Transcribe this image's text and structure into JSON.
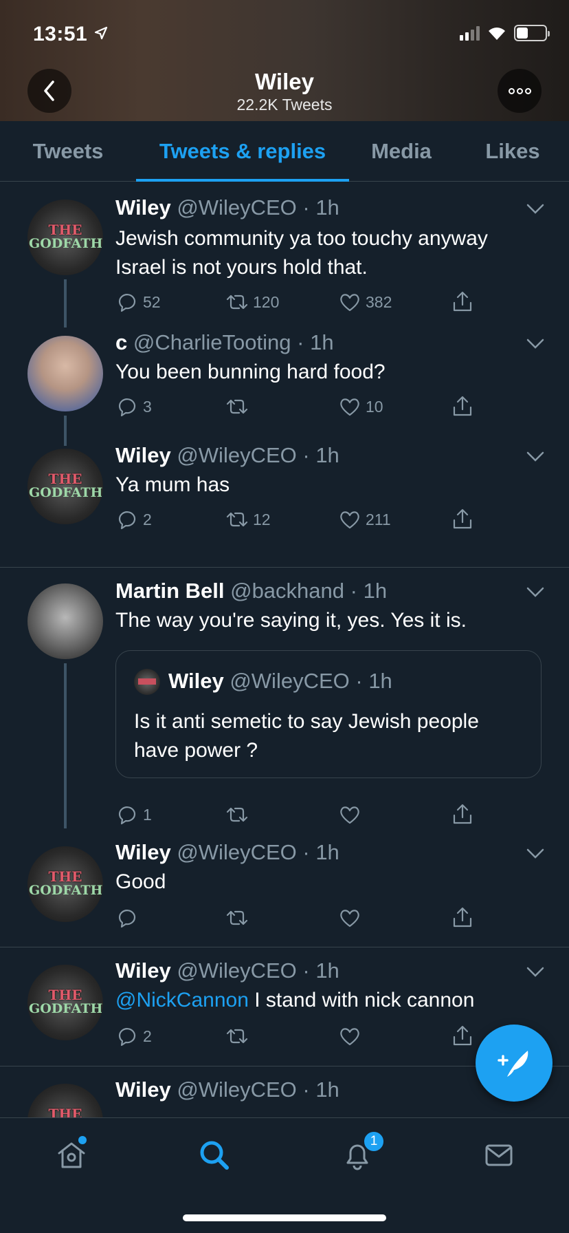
{
  "status_bar": {
    "time": "13:51"
  },
  "profile_header": {
    "name": "Wiley",
    "tweet_count": "22.2K Tweets"
  },
  "tabs": [
    {
      "label": "Tweets"
    },
    {
      "label": "Tweets & replies",
      "active": true
    },
    {
      "label": "Media"
    },
    {
      "label": "Likes"
    }
  ],
  "tweets": [
    {
      "name": "Wiley",
      "handle": "@WileyCEO",
      "time": "1h",
      "text": "Jewish community ya too touchy anyway Israel is not yours hold that.",
      "replies": "52",
      "retweets": "120",
      "likes": "382"
    },
    {
      "name": "c",
      "handle": "@CharlieTooting",
      "time": "1h",
      "text": "You been bunning hard food?",
      "replies": "3",
      "retweets": "",
      "likes": "10"
    },
    {
      "name": "Wiley",
      "handle": "@WileyCEO",
      "time": "1h",
      "text": "Ya mum has",
      "replies": "2",
      "retweets": "12",
      "likes": "211"
    },
    {
      "name": "Martin Bell",
      "handle": "@backhand",
      "time": "1h",
      "text": "The way you're saying it, yes. Yes it is.",
      "quote": {
        "name": "Wiley",
        "handle": "@WileyCEO",
        "time": "1h",
        "text": "Is it anti semetic to say Jewish people have power ?"
      },
      "replies": "1",
      "retweets": "",
      "likes": ""
    },
    {
      "name": "Wiley",
      "handle": "@WileyCEO",
      "time": "1h",
      "text": "Good",
      "replies": "",
      "retweets": "",
      "likes": ""
    },
    {
      "name": "Wiley",
      "handle": "@WileyCEO",
      "time": "1h",
      "mention": "@NickCannon",
      "text": " I stand with nick cannon",
      "replies": "2",
      "retweets": "",
      "likes": ""
    },
    {
      "name": "Wiley",
      "handle": "@WileyCEO",
      "time": "1h"
    }
  ],
  "avatar_text": {
    "line1": "THE",
    "line2": "GODFATHER"
  },
  "separator": " · ",
  "bottom_nav": {
    "items": [
      "home-icon",
      "search-icon",
      "notifications-icon",
      "messages-icon"
    ],
    "notification_count": "1"
  },
  "colors": {
    "accent": "#1da1f2",
    "background": "#15202b",
    "muted": "#8899a6",
    "border": "#38444d"
  }
}
